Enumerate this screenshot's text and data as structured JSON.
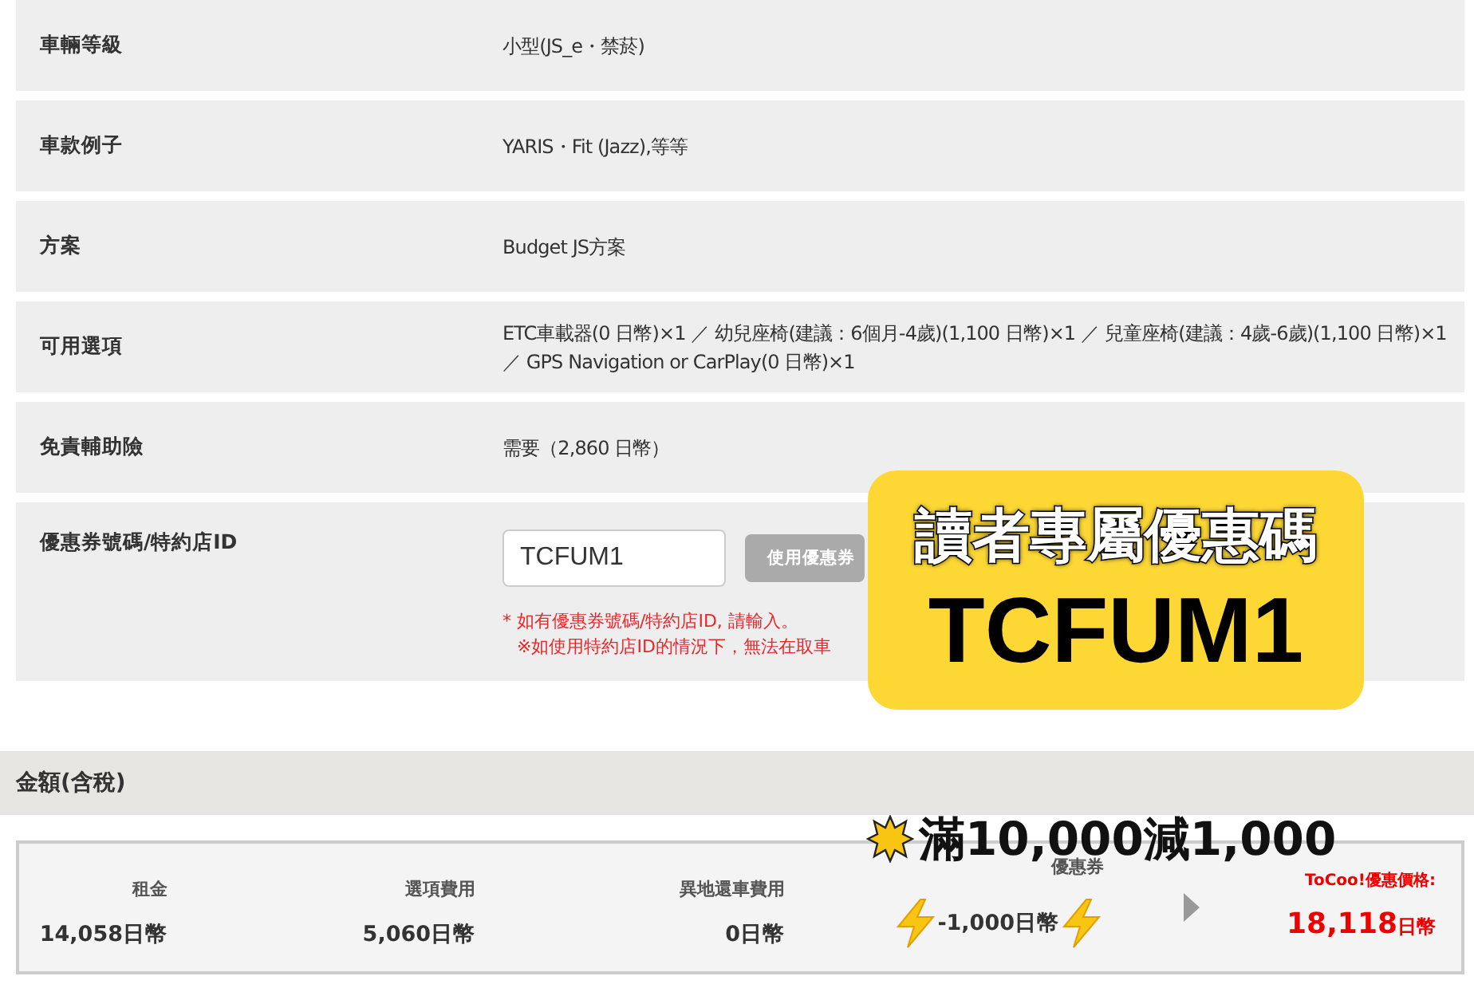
{
  "details": [
    {
      "label": "車輛等級",
      "value": "小型(JS_e・禁菸)"
    },
    {
      "label": "車款例子",
      "value": "YARIS・Fit (Jazz),等等"
    },
    {
      "label": "方案",
      "value": "Budget JS方案"
    },
    {
      "label": "可用選項",
      "value": "ETC車載器(0 日幣)×1 ／ 幼兒座椅(建議：6個月-4歲)(1,100 日幣)×1 ／ 兒童座椅(建議：4歲-6歲)(1,100 日幣)×1 ／ GPS Navigation or CarPlay(0 日幣)×1"
    },
    {
      "label": "免責輔助險",
      "value": "需要（2,860 日幣）"
    }
  ],
  "coupon": {
    "label": "優惠券號碼/特約店ID",
    "value": "TCFUM1",
    "button": "使用優惠券",
    "notes": [
      "* 如有優惠券號碼/特約店ID, 請輸入。",
      "※如使用特約店ID的情況下，無法在取車"
    ]
  },
  "promo_badge": {
    "title": "讀者專屬優惠碼",
    "code": "TCFUM1"
  },
  "total_section": {
    "title": "金額(含稅)",
    "promo_text": "滿10,000減1,000",
    "items": [
      {
        "label": "租金",
        "value": "14,058日幣"
      },
      {
        "label": "選項費用",
        "value": "5,060日幣"
      },
      {
        "label": "異地還車費用",
        "value": "0日幣"
      },
      {
        "label": "優惠券",
        "value": "-1,000日幣"
      }
    ],
    "final": {
      "label": "ToCoo!優惠價格:",
      "amount": "18,118",
      "unit": "日幣"
    }
  }
}
